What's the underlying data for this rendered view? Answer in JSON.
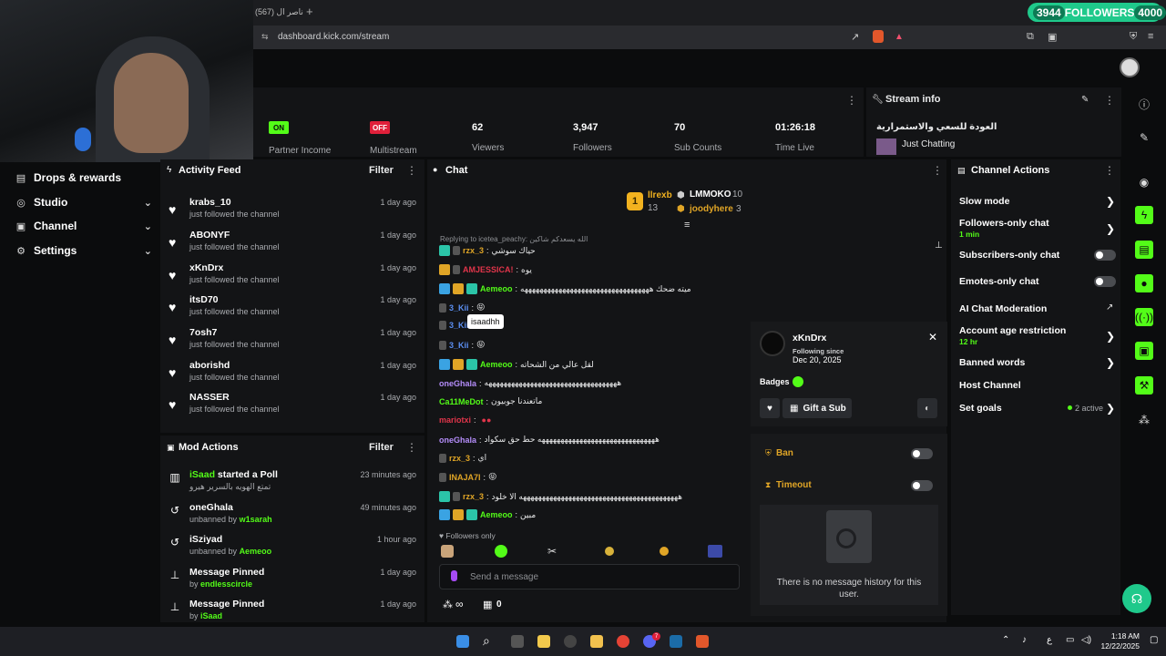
{
  "browser": {
    "tab_title": "ناصر ال (567)",
    "tab_plus": "+",
    "url": "dashboard.kick.com/stream",
    "followers_pill": {
      "left": "3944",
      "label": "FOLLOWERS",
      "right": "4000"
    }
  },
  "stats": [
    {
      "badge": "ON",
      "label": "Partner Income"
    },
    {
      "badge": "OFF",
      "label": "Multistream"
    },
    {
      "value": "62",
      "label": "Viewers"
    },
    {
      "value": "3,947",
      "label": "Followers"
    },
    {
      "value": "70",
      "label": "Sub Counts"
    },
    {
      "value": "01:26:18",
      "label": "Time Live"
    }
  ],
  "stream_info": {
    "title": "Stream info",
    "stream_title": "العودة للسعي والاستمرارية",
    "category": "Just Chatting"
  },
  "nav": [
    {
      "label": "Drops & rewards",
      "icon": "drops-icon"
    },
    {
      "label": "Studio",
      "icon": "studio-icon"
    },
    {
      "label": "Channel",
      "icon": "channel-icon"
    },
    {
      "label": "Settings",
      "icon": "gear-icon"
    }
  ],
  "activity_feed": {
    "title": "Activity Feed",
    "filter": "Filter",
    "items": [
      {
        "name": "krabs_10",
        "sub": "just followed the channel",
        "time": "1 day ago"
      },
      {
        "name": "ABONYF",
        "sub": "just followed the channel",
        "time": "1 day ago"
      },
      {
        "name": "xKnDrx",
        "sub": "just followed the channel",
        "time": "1 day ago"
      },
      {
        "name": "itsD70",
        "sub": "just followed the channel",
        "time": "1 day ago"
      },
      {
        "name": "7osh7",
        "sub": "just followed the channel",
        "time": "1 day ago"
      },
      {
        "name": "aborishd",
        "sub": "just followed the channel",
        "time": "1 day ago"
      },
      {
        "name": "NASSER",
        "sub": "just followed the channel",
        "time": "1 day ago"
      }
    ]
  },
  "mod_actions": {
    "title": "Mod Actions",
    "filter": "Filter",
    "items": [
      {
        "name_a": "iSaad",
        "name_b": " started a Poll",
        "sub": "تمتع الهويه بالسرير هيرو",
        "sub_user": "",
        "time": "23 minutes ago"
      },
      {
        "name_a": "",
        "name_b": "oneGhala",
        "sub": "unbanned by ",
        "sub_user": "w1sarah",
        "time": "49 minutes ago"
      },
      {
        "name_a": "",
        "name_b": "iSziyad",
        "sub": "unbanned by ",
        "sub_user": "Aemeoo",
        "time": "1 hour ago"
      },
      {
        "name_a": "",
        "name_b": "Message Pinned",
        "sub": "by ",
        "sub_user": "endlesscircle",
        "time": "1 day ago"
      },
      {
        "name_a": "",
        "name_b": "Message Pinned",
        "sub": "by ",
        "sub_user": "iSaad",
        "time": "1 day ago"
      }
    ]
  },
  "chat": {
    "title": "Chat",
    "leaderboard": {
      "rank": "1",
      "first": {
        "name": "llrexb",
        "count": "13"
      },
      "second": {
        "name": "LMMOKO",
        "count": "10"
      },
      "third": {
        "name": "joodyhere",
        "count": "3"
      }
    },
    "reply_to": "Replying to icetea_peachy: الله يسعدكم شاكين",
    "messages": [
      {
        "user": "rzx_3",
        "color": "#e0a526",
        "text": "حياك سوشي"
      },
      {
        "user": "AMJESSICA!",
        "color": "#e0354a",
        "text": "يوه"
      },
      {
        "user": "Aemeoo",
        "color": "#53fc18",
        "text": "ميته ضحك ههههههههههههههههههههههههههههههههههه"
      },
      {
        "user": "3_Kii",
        "color": "#5b8ef0",
        "text": "😝"
      },
      {
        "user": "3_Kii",
        "color": "#5b8ef0",
        "text": ""
      },
      {
        "user": "3_Kii",
        "color": "#5b8ef0",
        "text": "😝"
      },
      {
        "user": "Aemeoo",
        "color": "#53fc18",
        "text": "لقل عالي من الشحاته"
      },
      {
        "user": "oneGhala",
        "color": "#b38cf8",
        "text": "هههههههههههههههههههههههههههههههههههه"
      },
      {
        "user": "Ca11MeDot",
        "color": "#53fc18",
        "text": "ماتعندنا جوبيون"
      },
      {
        "user": "mariotxi",
        "color": "#e0354a",
        "text": ""
      },
      {
        "user": "oneGhala",
        "color": "#b38cf8",
        "text": "هههههههههههههههههههههههههههههههه حط حق سكواد"
      },
      {
        "user": "rzx_3",
        "color": "#e0a526",
        "text": "اي"
      },
      {
        "user": "INAJA7I",
        "color": "#e0a526",
        "text": "😝"
      },
      {
        "user": "rzx_3",
        "color": "#e0a526",
        "text": "ههههههههههههههههههههههههههههههههههههههههههه الا خلود"
      },
      {
        "user": "Aemeoo",
        "color": "#53fc18",
        "text": "مبين"
      }
    ],
    "tooltip": "isaadhh",
    "followers_only": "Followers only",
    "input_placeholder": "Send a message",
    "footer_count": "0",
    "footer_infinity": "∞"
  },
  "user_card": {
    "username": "xKnDrx",
    "following_since_label": "Following since",
    "following_since": "Dec 20, 2025",
    "badges_label": "Badges",
    "gift_button": "Gift a Sub",
    "ban_label": "Ban",
    "timeout_label": "Timeout",
    "empty_history": "There is no message history for this user."
  },
  "channel_actions": {
    "title": "Channel Actions",
    "items": [
      {
        "label": "Slow mode",
        "sub": ""
      },
      {
        "label": "Followers-only chat",
        "sub": "1 min"
      },
      {
        "label": "Subscribers-only chat",
        "sub": ""
      },
      {
        "label": "Emotes-only chat",
        "sub": ""
      },
      {
        "label": "AI Chat Moderation",
        "sub": ""
      },
      {
        "label": "Account age restriction",
        "sub": "12 hr"
      },
      {
        "label": "Banned words",
        "sub": ""
      },
      {
        "label": "Host Channel",
        "sub": ""
      },
      {
        "label": "Set goals",
        "sub": ""
      }
    ],
    "set_goals_status": "2 active"
  },
  "taskbar": {
    "time": "1:18 AM",
    "date": "12/22/2025",
    "lang": "ع",
    "badge": "7"
  },
  "colors": {
    "accent": "#53fc18",
    "panel": "#131416",
    "bg": "#0b0c0d",
    "followers_pill": "#1fc98b"
  }
}
